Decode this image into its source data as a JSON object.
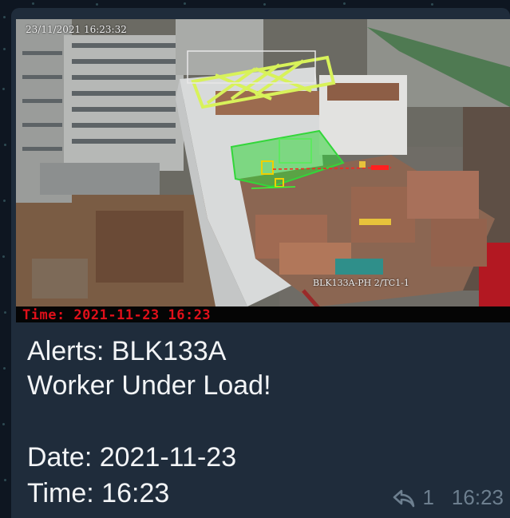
{
  "photo": {
    "cctv_timestamp": "23/11/2021 16:23:32",
    "camera_label": "BLK133A-PH 2/TC1-1",
    "time_overlay": "Time: 2021-11-23 16:23"
  },
  "message": {
    "line1": "Alerts: BLK133A",
    "line2": "Worker Under Load!",
    "line3": "Date: 2021-11-23",
    "line4": "Time: 16:23"
  },
  "meta": {
    "reply_count": "1",
    "time": "16:23",
    "reply_icon": "reply-arrow-icon"
  },
  "colors": {
    "bubble": "#1f2c3b",
    "chat_bg": "#0e1621",
    "alert_zone": "#33d63a",
    "load_frame": "#d8f25a",
    "overlay_red": "#e0101a"
  }
}
